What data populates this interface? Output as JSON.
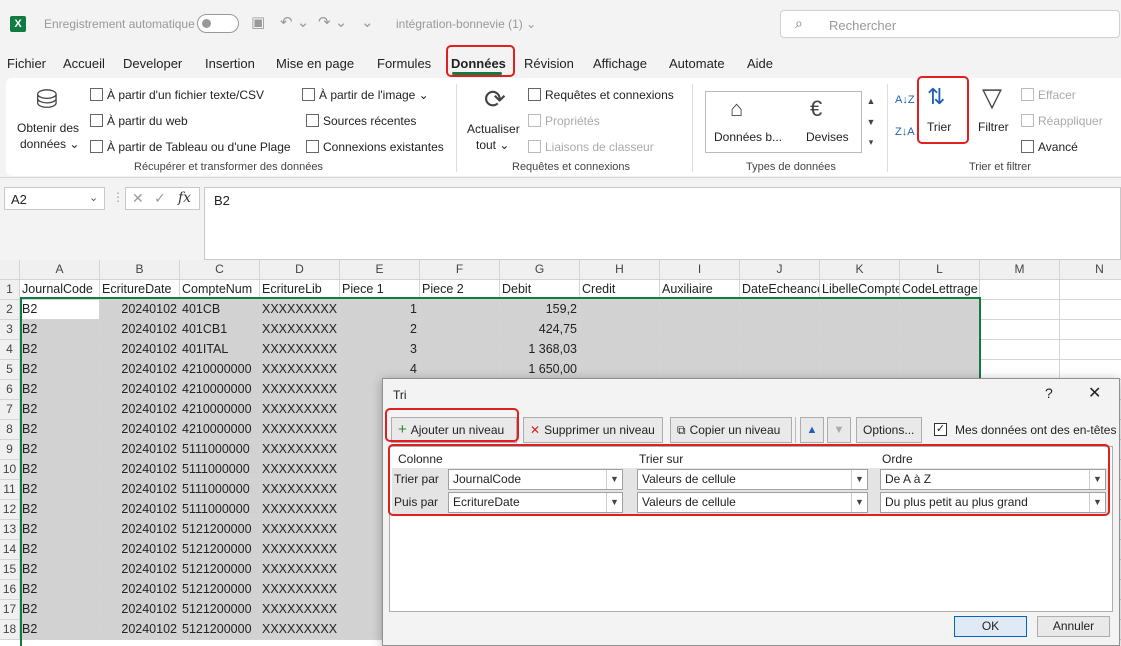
{
  "titlebar": {
    "autosave_label": "Enregistrement automatique",
    "filename": "intégration-bonnevie (1)",
    "filename_chevron": "⌄",
    "search_placeholder": "Rechercher",
    "app_icon": "X"
  },
  "menu": {
    "items": [
      "Fichier",
      "Accueil",
      "Developer",
      "Insertion",
      "Mise en page",
      "Formules",
      "Données",
      "Révision",
      "Affichage",
      "Automate",
      "Aide"
    ],
    "active": "Données"
  },
  "ribbon": {
    "get_data": "Obtenir des",
    "get_data_line2": "données ⌄",
    "from_text": "À partir d'un fichier texte/CSV",
    "from_web": "À partir du web",
    "from_table": "À partir de Tableau ou d'une Plage",
    "from_image": "À partir de l'image ⌄",
    "recent_sources": "Sources récentes",
    "existing_connections": "Connexions existantes",
    "group_get_transform": "Récupérer et transformer des données",
    "refresh_all": "Actualiser",
    "refresh_all_line2": "tout ⌄",
    "queries_connections": "Requêtes et connexions",
    "properties": "Propriétés",
    "edit_links": "Liaisons de classeur",
    "group_queries": "Requêtes et connexions",
    "stocks": "Données b...",
    "currencies": "Devises",
    "group_data_types": "Types de données",
    "sort_az": "A↓Z",
    "sort_za": "Z↓A",
    "sort": "Trier",
    "filter": "Filtrer",
    "clear": "Effacer",
    "reapply": "Réappliquer",
    "advanced": "Avancé",
    "group_sort_filter": "Trier et filtrer"
  },
  "formula_bar": {
    "name_box": "A2",
    "fx": "fx",
    "content": "B2"
  },
  "grid": {
    "col_headers": [
      "A",
      "B",
      "C",
      "D",
      "E",
      "F",
      "G",
      "H",
      "I",
      "J",
      "K",
      "L",
      "M",
      "N"
    ],
    "header_row": [
      "JournalCode",
      "EcritureDate",
      "CompteNum",
      "EcritureLib",
      "Piece 1",
      "Piece 2",
      "Debit",
      "Credit",
      "Auxiliaire",
      "DateEcheance",
      "LibelleCompte",
      "CodeLettrage"
    ],
    "rows": [
      {
        "n": "2",
        "a": "B2",
        "b": "20240102",
        "c": "401CB",
        "d": "XXXXXXXXX",
        "e": "1",
        "g": "159,2"
      },
      {
        "n": "3",
        "a": "B2",
        "b": "20240102",
        "c": "401CB1",
        "d": "XXXXXXXXX",
        "e": "2",
        "g": "424,75"
      },
      {
        "n": "4",
        "a": "B2",
        "b": "20240102",
        "c": "401ITAL",
        "d": "XXXXXXXXX",
        "e": "3",
        "g": "1 368,03"
      },
      {
        "n": "5",
        "a": "B2",
        "b": "20240102",
        "c": "4210000000",
        "d": "XXXXXXXXX",
        "e": "4",
        "g": "1 650,00"
      },
      {
        "n": "6",
        "a": "B2",
        "b": "20240102",
        "c": "4210000000",
        "d": "XXXXXXXXX"
      },
      {
        "n": "7",
        "a": "B2",
        "b": "20240102",
        "c": "4210000000",
        "d": "XXXXXXXXX"
      },
      {
        "n": "8",
        "a": "B2",
        "b": "20240102",
        "c": "4210000000",
        "d": "XXXXXXXXX"
      },
      {
        "n": "9",
        "a": "B2",
        "b": "20240102",
        "c": "5111000000",
        "d": "XXXXXXXXX"
      },
      {
        "n": "10",
        "a": "B2",
        "b": "20240102",
        "c": "5111000000",
        "d": "XXXXXXXXX"
      },
      {
        "n": "11",
        "a": "B2",
        "b": "20240102",
        "c": "5111000000",
        "d": "XXXXXXXXX"
      },
      {
        "n": "12",
        "a": "B2",
        "b": "20240102",
        "c": "5111000000",
        "d": "XXXXXXXXX"
      },
      {
        "n": "13",
        "a": "B2",
        "b": "20240102",
        "c": "5121200000",
        "d": "XXXXXXXXX"
      },
      {
        "n": "14",
        "a": "B2",
        "b": "20240102",
        "c": "5121200000",
        "d": "XXXXXXXXX"
      },
      {
        "n": "15",
        "a": "B2",
        "b": "20240102",
        "c": "5121200000",
        "d": "XXXXXXXXX"
      },
      {
        "n": "16",
        "a": "B2",
        "b": "20240102",
        "c": "5121200000",
        "d": "XXXXXXXXX"
      },
      {
        "n": "17",
        "a": "B2",
        "b": "20240102",
        "c": "5121200000",
        "d": "XXXXXXXXX"
      },
      {
        "n": "18",
        "a": "B2",
        "b": "20240102",
        "c": "5121200000",
        "d": "XXXXXXXXX"
      }
    ]
  },
  "dialog": {
    "title": "Tri",
    "help": "?",
    "close": "✕",
    "add_level": "Ajouter un niveau",
    "delete_level": "Supprimer un niveau",
    "copy_level": "Copier un niveau",
    "options": "Options...",
    "has_headers": "Mes données ont des en-têtes",
    "col_column": "Colonne",
    "col_sort_on": "Trier sur",
    "col_order": "Ordre",
    "levels": [
      {
        "label": "Trier par",
        "column": "JournalCode",
        "sort_on": "Valeurs de cellule",
        "order": "De A à Z"
      },
      {
        "label": "Puis par",
        "column": "EcritureDate",
        "sort_on": "Valeurs de cellule",
        "order": "Du plus petit au plus grand"
      }
    ],
    "ok": "OK",
    "cancel": "Annuler"
  }
}
